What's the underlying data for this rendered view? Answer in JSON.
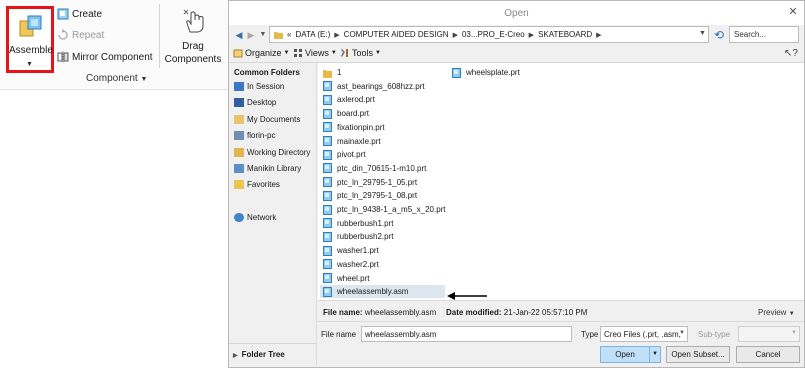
{
  "ribbon": {
    "assemble_label": "Assemble",
    "create_label": "Create",
    "repeat_label": "Repeat",
    "mirror_label": "Mirror Component",
    "drag_label_line1": "Drag",
    "drag_label_line2": "Components",
    "group_label": "Component"
  },
  "dialog": {
    "title": "Open",
    "breadcrumb": [
      "DATA (E:)",
      "COMPUTER AIDED DESIGN",
      "03...PRO_E-Creo",
      "SKATEBOARD"
    ],
    "search_placeholder": "Search...",
    "toolbar": {
      "organize": "Organize",
      "views": "Views",
      "tools": "Tools"
    },
    "sidebar": {
      "heading": "Common Folders",
      "items": [
        "In Session",
        "Desktop",
        "My Documents",
        "florin-pc",
        "Working Directory",
        "Manikin Library",
        "Favorites",
        "Network"
      ],
      "folder_tree": "Folder Tree"
    },
    "files_col1": [
      "1",
      "ast_bearings_608hzz.prt",
      "axlerod.prt",
      "board.prt",
      "fixationpin.prt",
      "mainaxle.prt",
      "pivot.prt",
      "ptc_din_70615-1-m10.prt",
      "ptc_ln_29795-1_05.prt",
      "ptc_ln_29795-1_08.prt",
      "ptc_ln_9438-1_a_m5_x_20.prt",
      "rubberbush1.prt",
      "rubberbush2.prt",
      "washer1.prt",
      "washer2.prt",
      "wheel.prt",
      "wheelassembly.asm"
    ],
    "files_col2": [
      "wheelsplate.prt"
    ],
    "info": {
      "file_name_label": "File name:",
      "file_name_value": "wheelassembly.asm",
      "date_label": "Date modified:",
      "date_value": "21-Jan-22 05:57:10 PM",
      "preview": "Preview"
    },
    "bottom": {
      "file_name_label": "File name",
      "file_name_value": "wheelassembly.asm",
      "type_label": "Type",
      "type_value": "Creo Files (.prt, .asm,",
      "subtype_label": "Sub-type",
      "open": "Open",
      "open_subset": "Open Subset...",
      "cancel": "Cancel"
    }
  },
  "colors": {
    "highlight_border": "#e3141a",
    "selected_row": "#dde6ee",
    "primary_button": "#bfe0f8"
  }
}
